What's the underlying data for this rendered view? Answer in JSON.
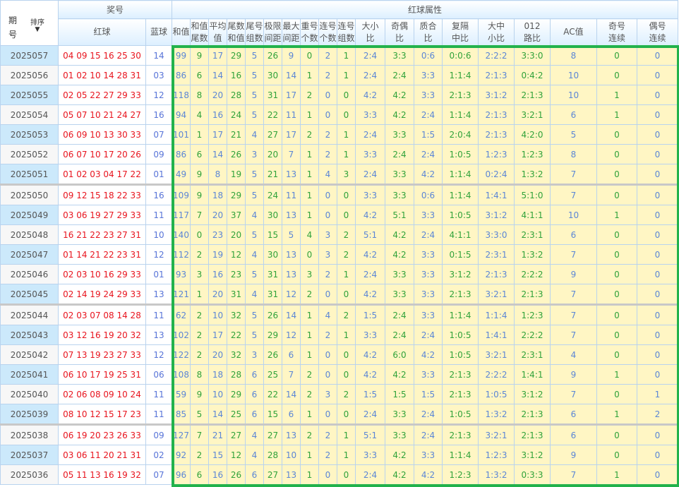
{
  "header": {
    "period": "期号",
    "sort": "排序",
    "prize_number": "奖号",
    "red_ball": "红球",
    "blue_ball": "蓝球",
    "red_attrs": "红球属性",
    "attr_cols": [
      [
        "和值",
        ""
      ],
      [
        "和值",
        "尾数"
      ],
      [
        "平均",
        "值"
      ],
      [
        "尾数",
        "和值"
      ],
      [
        "尾号",
        "组数"
      ],
      [
        "极限",
        "间距"
      ],
      [
        "最大",
        "间距"
      ],
      [
        "重号",
        "个数"
      ],
      [
        "连号",
        "个数"
      ],
      [
        "连号",
        "组数"
      ],
      [
        "大小",
        "比"
      ],
      [
        "奇偶",
        "比"
      ],
      [
        "质合",
        "比"
      ],
      [
        "复隔",
        "中比"
      ],
      [
        "大中",
        "小比"
      ],
      [
        "012",
        "路比"
      ],
      [
        "AC值",
        ""
      ],
      [
        "奇号",
        "连续"
      ],
      [
        "偶号",
        "连续"
      ]
    ]
  },
  "rows": [
    {
      "period": "2025057",
      "red": "04 09 15 16 25 30",
      "blue": "14",
      "attrs": [
        "99",
        "9",
        "17",
        "29",
        "5",
        "26",
        "9",
        "0",
        "2",
        "1",
        "2:4",
        "3:3",
        "0:6",
        "0:0:6",
        "2:2:2",
        "3:3:0",
        "8",
        "0",
        "0"
      ]
    },
    {
      "period": "2025056",
      "red": "01 02 10 14 28 31",
      "blue": "03",
      "attrs": [
        "86",
        "6",
        "14",
        "16",
        "5",
        "30",
        "14",
        "1",
        "2",
        "1",
        "2:4",
        "2:4",
        "3:3",
        "1:1:4",
        "2:1:3",
        "0:4:2",
        "10",
        "0",
        "0"
      ]
    },
    {
      "period": "2025055",
      "red": "02 05 22 27 29 33",
      "blue": "12",
      "attrs": [
        "118",
        "8",
        "20",
        "28",
        "5",
        "31",
        "17",
        "2",
        "0",
        "0",
        "4:2",
        "4:2",
        "3:3",
        "2:1:3",
        "3:1:2",
        "2:1:3",
        "10",
        "1",
        "0"
      ]
    },
    {
      "period": "2025054",
      "red": "05 07 10 21 24 27",
      "blue": "16",
      "attrs": [
        "94",
        "4",
        "16",
        "24",
        "5",
        "22",
        "11",
        "1",
        "0",
        "0",
        "3:3",
        "4:2",
        "2:4",
        "1:1:4",
        "2:1:3",
        "3:2:1",
        "6",
        "1",
        "0"
      ]
    },
    {
      "period": "2025053",
      "red": "06 09 10 13 30 33",
      "blue": "07",
      "attrs": [
        "101",
        "1",
        "17",
        "21",
        "4",
        "27",
        "17",
        "2",
        "2",
        "1",
        "2:4",
        "3:3",
        "1:5",
        "2:0:4",
        "2:1:3",
        "4:2:0",
        "5",
        "0",
        "0"
      ]
    },
    {
      "period": "2025052",
      "red": "06 07 10 17 20 26",
      "blue": "09",
      "attrs": [
        "86",
        "6",
        "14",
        "26",
        "3",
        "20",
        "7",
        "1",
        "2",
        "1",
        "3:3",
        "2:4",
        "2:4",
        "1:0:5",
        "1:2:3",
        "1:2:3",
        "8",
        "0",
        "0"
      ]
    },
    {
      "period": "2025051",
      "red": "01 02 03 04 17 22",
      "blue": "01",
      "attrs": [
        "49",
        "9",
        "8",
        "19",
        "5",
        "21",
        "13",
        "1",
        "4",
        "3",
        "2:4",
        "3:3",
        "4:2",
        "1:1:4",
        "0:2:4",
        "1:3:2",
        "7",
        "0",
        "0"
      ]
    },
    {
      "period": "2025050",
      "red": "09 12 15 18 22 33",
      "blue": "16",
      "attrs": [
        "109",
        "9",
        "18",
        "29",
        "5",
        "24",
        "11",
        "1",
        "0",
        "0",
        "3:3",
        "3:3",
        "0:6",
        "1:1:4",
        "1:4:1",
        "5:1:0",
        "7",
        "0",
        "0"
      ]
    },
    {
      "period": "2025049",
      "red": "03 06 19 27 29 33",
      "blue": "11",
      "attrs": [
        "117",
        "7",
        "20",
        "37",
        "4",
        "30",
        "13",
        "1",
        "0",
        "0",
        "4:2",
        "5:1",
        "3:3",
        "1:0:5",
        "3:1:2",
        "4:1:1",
        "10",
        "1",
        "0"
      ]
    },
    {
      "period": "2025048",
      "red": "16 21 22 23 27 31",
      "blue": "10",
      "attrs": [
        "140",
        "0",
        "23",
        "20",
        "5",
        "15",
        "5",
        "4",
        "3",
        "2",
        "5:1",
        "4:2",
        "2:4",
        "4:1:1",
        "3:3:0",
        "2:3:1",
        "6",
        "0",
        "0"
      ]
    },
    {
      "period": "2025047",
      "red": "01 14 21 22 23 31",
      "blue": "12",
      "attrs": [
        "112",
        "2",
        "19",
        "12",
        "4",
        "30",
        "13",
        "0",
        "3",
        "2",
        "4:2",
        "4:2",
        "3:3",
        "0:1:5",
        "2:3:1",
        "1:3:2",
        "7",
        "0",
        "0"
      ]
    },
    {
      "period": "2025046",
      "red": "02 03 10 16 29 33",
      "blue": "01",
      "attrs": [
        "93",
        "3",
        "16",
        "23",
        "5",
        "31",
        "13",
        "3",
        "2",
        "1",
        "2:4",
        "3:3",
        "3:3",
        "3:1:2",
        "2:1:3",
        "2:2:2",
        "9",
        "0",
        "0"
      ]
    },
    {
      "period": "2025045",
      "red": "02 14 19 24 29 33",
      "blue": "13",
      "attrs": [
        "121",
        "1",
        "20",
        "31",
        "4",
        "31",
        "12",
        "2",
        "0",
        "0",
        "4:2",
        "3:3",
        "3:3",
        "2:1:3",
        "3:2:1",
        "2:1:3",
        "7",
        "0",
        "0"
      ]
    },
    {
      "period": "2025044",
      "red": "02 03 07 08 14 28",
      "blue": "11",
      "attrs": [
        "62",
        "2",
        "10",
        "32",
        "5",
        "26",
        "14",
        "1",
        "4",
        "2",
        "1:5",
        "2:4",
        "3:3",
        "1:1:4",
        "1:1:4",
        "1:2:3",
        "7",
        "0",
        "0"
      ]
    },
    {
      "period": "2025043",
      "red": "03 12 16 19 20 32",
      "blue": "13",
      "attrs": [
        "102",
        "2",
        "17",
        "22",
        "5",
        "29",
        "12",
        "1",
        "2",
        "1",
        "3:3",
        "2:4",
        "2:4",
        "1:0:5",
        "1:4:1",
        "2:2:2",
        "7",
        "0",
        "0"
      ]
    },
    {
      "period": "2025042",
      "red": "07 13 19 23 27 33",
      "blue": "12",
      "attrs": [
        "122",
        "2",
        "20",
        "32",
        "3",
        "26",
        "6",
        "1",
        "0",
        "0",
        "4:2",
        "6:0",
        "4:2",
        "1:0:5",
        "3:2:1",
        "2:3:1",
        "4",
        "0",
        "0"
      ]
    },
    {
      "period": "2025041",
      "red": "06 10 17 19 25 31",
      "blue": "06",
      "attrs": [
        "108",
        "8",
        "18",
        "28",
        "6",
        "25",
        "7",
        "2",
        "0",
        "0",
        "4:2",
        "4:2",
        "3:3",
        "2:1:3",
        "2:2:2",
        "1:4:1",
        "9",
        "1",
        "0"
      ]
    },
    {
      "period": "2025040",
      "red": "02 06 08 09 10 24",
      "blue": "11",
      "attrs": [
        "59",
        "9",
        "10",
        "29",
        "6",
        "22",
        "14",
        "2",
        "3",
        "2",
        "1:5",
        "1:5",
        "1:5",
        "2:1:3",
        "1:0:5",
        "3:1:2",
        "7",
        "0",
        "1"
      ]
    },
    {
      "period": "2025039",
      "red": "08 10 12 15 17 23",
      "blue": "11",
      "attrs": [
        "85",
        "5",
        "14",
        "25",
        "6",
        "15",
        "6",
        "1",
        "0",
        "0",
        "2:4",
        "3:3",
        "2:4",
        "1:0:5",
        "1:3:2",
        "2:1:3",
        "6",
        "1",
        "2"
      ]
    },
    {
      "period": "2025038",
      "red": "06 19 20 23 26 33",
      "blue": "09",
      "attrs": [
        "127",
        "7",
        "21",
        "27",
        "4",
        "27",
        "13",
        "2",
        "2",
        "1",
        "5:1",
        "3:3",
        "2:4",
        "2:1:3",
        "3:2:1",
        "2:1:3",
        "6",
        "0",
        "0"
      ]
    },
    {
      "period": "2025037",
      "red": "03 06 11 20 21 31",
      "blue": "02",
      "attrs": [
        "92",
        "2",
        "15",
        "12",
        "4",
        "28",
        "10",
        "1",
        "2",
        "1",
        "3:3",
        "4:2",
        "3:3",
        "1:1:4",
        "1:2:3",
        "3:1:2",
        "9",
        "0",
        "0"
      ]
    },
    {
      "period": "2025036",
      "red": "05 11 13 16 19 32",
      "blue": "07",
      "attrs": [
        "96",
        "6",
        "16",
        "26",
        "6",
        "27",
        "13",
        "1",
        "0",
        "0",
        "2:4",
        "4:2",
        "4:2",
        "1:2:3",
        "1:3:2",
        "0:3:3",
        "7",
        "1",
        "0"
      ]
    }
  ]
}
